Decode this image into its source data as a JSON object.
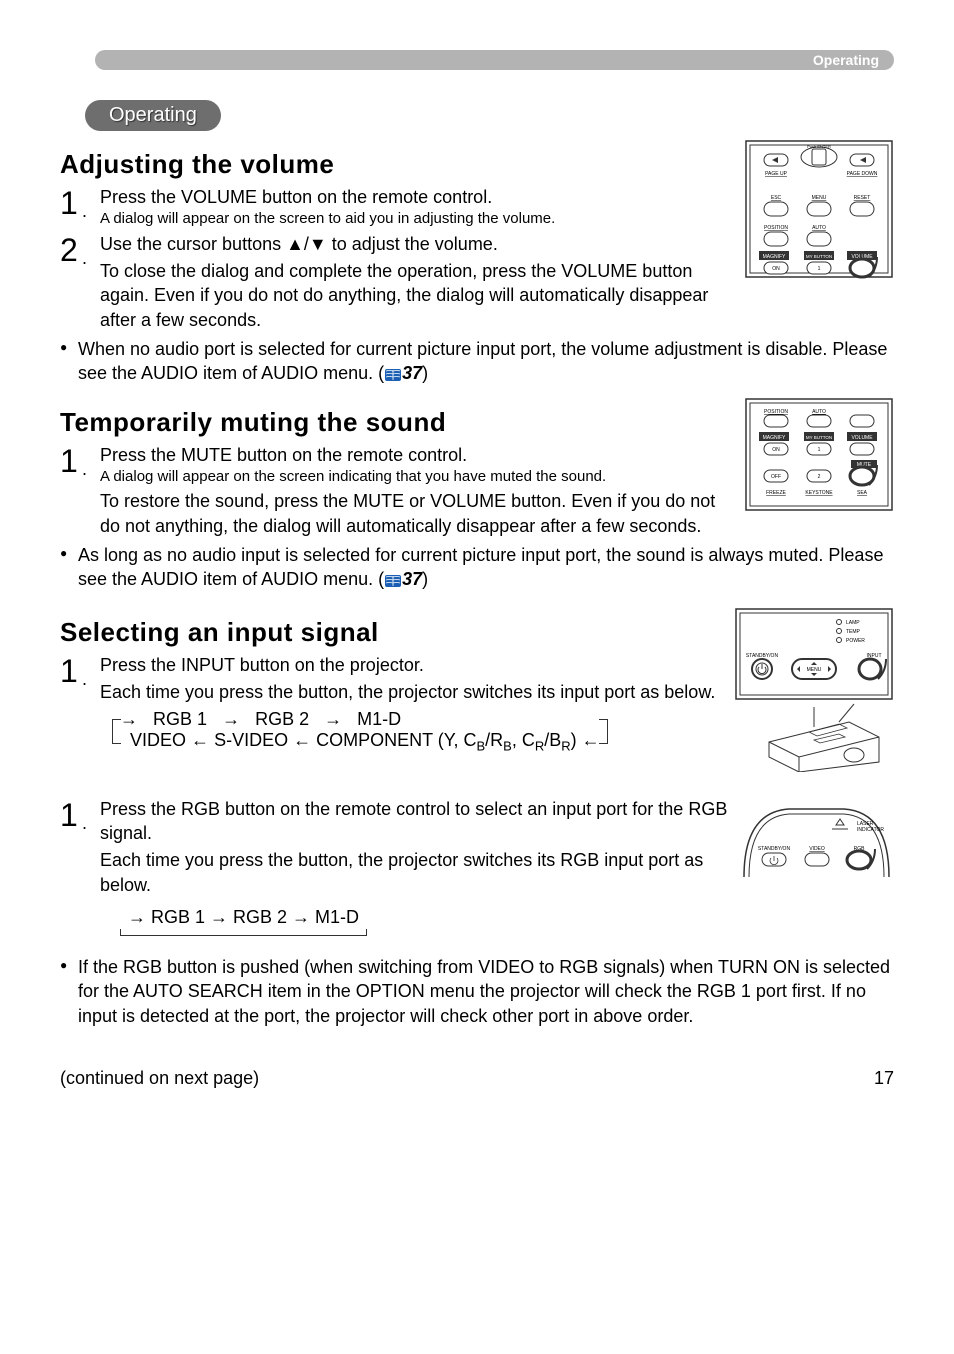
{
  "header": {
    "section": "Operating"
  },
  "tab": {
    "label": "Operating"
  },
  "h2_1": "Adjusting the volume",
  "vol_step1_main": "Press the VOLUME button on the remote control.",
  "vol_step1_sub": "A dialog will appear on the screen to aid you in adjusting the volume.",
  "vol_step2_main": "Use the cursor buttons ▲/▼ to adjust the volume.",
  "vol_step2_body": "To close the dialog and complete the operation, press the VOLUME button again. Even if you do not do anything, the dialog will automatically disappear after a few seconds.",
  "vol_bullet_a": "When no audio port is selected for current picture input port, the volume adjustment is disable. Please see the AUDIO item of AUDIO menu. (",
  "ref37": "37",
  "vol_bullet_c": ")",
  "h2_2": "Temporarily muting the sound",
  "mute_step1_main": "Press the MUTE button on the remote control.",
  "mute_step1_sub": "A dialog will appear on the screen indicating that you have muted the sound.",
  "mute_body": "To restore the sound, press the MUTE or VOLUME button. Even if you do not do not anything, the dialog will automatically disappear after a few seconds.",
  "mute_bullet_a": "As long as no audio input is selected for current picture input port, the sound is always muted. Please see the AUDIO item of AUDIO menu. (",
  "mute_bullet_c": ")",
  "h2_3": "Selecting an input signal",
  "sel_step1_main": "Press the INPUT button on the projector.",
  "sel_step1_body": "Each time you press the button, the projector switches its input port as below.",
  "flow1_line1_a": "RGB 1",
  "flow1_line1_b": "RGB 2",
  "flow1_line1_c": "M1-D",
  "flow1_line2_a": "VIDEO",
  "flow1_line2_b": "S-VIDEO",
  "flow1_line2_c": "COMPONENT (Y, C",
  "flow1_line2_d": "/R",
  "flow1_line2_e": ", C",
  "flow1_line2_f": "/B",
  "flow1_line2_g": ")",
  "sub_b": "B",
  "sub_r": "R",
  "sel_step2_main": "Press the RGB button on the remote control to select an input port for the RGB signal.",
  "sel_step2_body": "Each time you press the button, the projector switches its RGB input port as below.",
  "flow2": "RGB 1 → RGB 2 → M1-D",
  "sel_bullet": "If the RGB button is pushed (when switching from VIDEO to RGB signals) when TURN ON is selected for the AUTO SEARCH item in the OPTION menu the projector will check the RGB 1 port first. If no input is detected at the port, the projector will check other port in above order.",
  "continued": "(continued on next page)",
  "page_num": "17",
  "remote1_labels": {
    "enter": "Push ENTER",
    "pageup": "PAGE UP",
    "pagedown": "PAGE DOWN",
    "esc": "ESC",
    "menu": "MENU",
    "reset": "RESET",
    "position": "POSITION",
    "auto": "AUTO",
    "magnify": "MAGNIFY",
    "mybutton": "MY BUTTON",
    "volume": "VOLUME",
    "on": "ON",
    "n1": "1"
  },
  "remote2_labels": {
    "position": "POSITION",
    "auto": "AUTO",
    "magnify": "MAGNIFY",
    "mybutton": "MY BUTTON",
    "volume": "VOLUME",
    "on": "ON",
    "off": "OFF",
    "n1": "1",
    "n2": "2",
    "mute": "MUTE",
    "freeze": "FREEZE",
    "keystone": "KEYSTONE",
    "sea": "SEA"
  },
  "projector_labels": {
    "lamp": "LAMP",
    "temp": "TEMP",
    "power": "POWER",
    "standby": "STANDBY/ON",
    "input": "INPUT",
    "menu": "MENU"
  },
  "remote3_labels": {
    "laser": "LASER",
    "indicator": "INDICATOR",
    "standby": "STANDBY/ON",
    "video": "VIDEO",
    "rgb": "RGB"
  }
}
